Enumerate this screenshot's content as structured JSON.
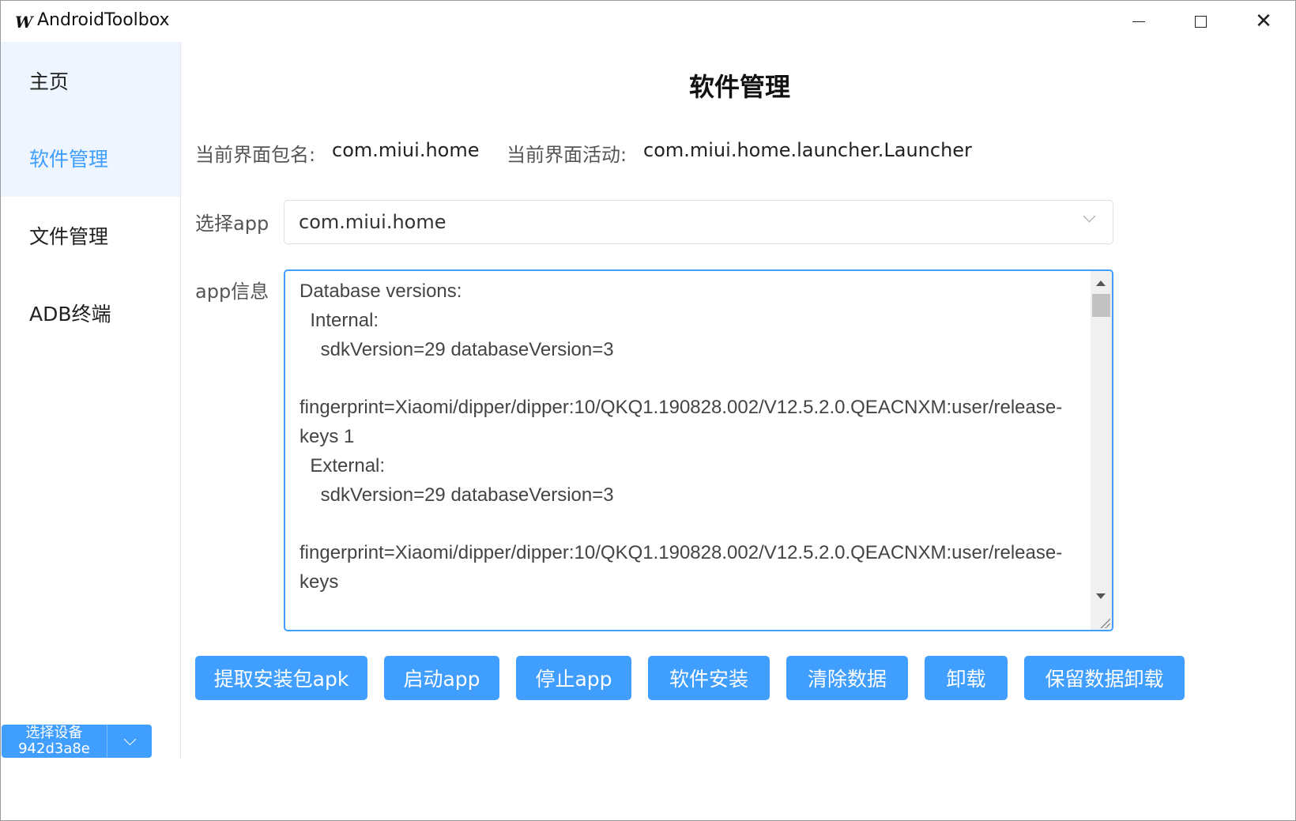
{
  "window": {
    "title": "AndroidToolbox",
    "logo_text": "W",
    "close_glyph": "✕"
  },
  "sidebar": {
    "items": [
      {
        "label": "主页"
      },
      {
        "label": "软件管理"
      },
      {
        "label": "文件管理"
      },
      {
        "label": "ADB终端"
      }
    ],
    "active_index": 1,
    "device_select": {
      "label": "选择设备",
      "device_id": "942d3a8e"
    }
  },
  "main": {
    "title": "软件管理",
    "current_package_label": "当前界面包名:",
    "current_package_value": "com.miui.home",
    "current_activity_label": "当前界面活动:",
    "current_activity_value": "com.miui.home.launcher.Launcher",
    "select_app_label": "选择app",
    "selected_app": "com.miui.home",
    "app_info_label": "app信息",
    "app_info_text": "Database versions:\n  Internal:\n    sdkVersion=29 databaseVersion=3\n\nfingerprint=Xiaomi/dipper/dipper:10/QKQ1.190828.002/V12.5.2.0.QEACNXM:user/release-keys 1\n  External:\n    sdkVersion=29 databaseVersion=3\n\nfingerprint=Xiaomi/dipper/dipper:10/QKQ1.190828.002/V12.5.2.0.QEACNXM:user/release-keys",
    "buttons": {
      "extract_apk": "提取安装包apk",
      "start_app": "启动app",
      "stop_app": "停止app",
      "install": "软件安装",
      "clear_data": "清除数据",
      "uninstall": "卸载",
      "uninstall_keep_data": "保留数据卸载"
    }
  },
  "colors": {
    "accent": "#409eff",
    "nav_active_bg": "#eef5fe"
  }
}
